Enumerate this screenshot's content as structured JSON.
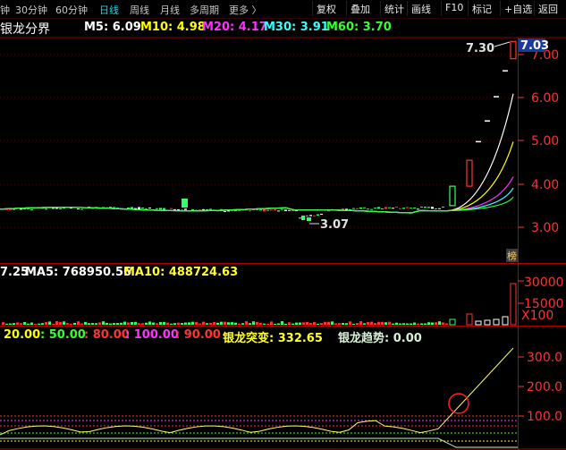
{
  "toolbar": {
    "periods": [
      "钟",
      "30分钟",
      "60分钟",
      "日线",
      "周线",
      "月线",
      "多周期",
      "更多 〉"
    ],
    "active_period": "日线",
    "buttons": [
      "复权",
      "叠加",
      "统计",
      "画线",
      "F10",
      "标记",
      "+自选",
      "返回"
    ]
  },
  "main_panel": {
    "title": "银龙分界",
    "ma": [
      {
        "label": "M5: 6.09",
        "color": "#ffffff"
      },
      {
        "label": "M10: 4.98",
        "color": "#ffff00"
      },
      {
        "label": "M20: 4.17",
        "color": "#ff33ff"
      },
      {
        "label": "M30: 3.91",
        "color": "#33ffff"
      },
      {
        "label": "M60: 3.70",
        "color": "#33ff33"
      }
    ],
    "price_axis": [
      "7.00",
      "6.00",
      "5.00",
      "4.00",
      "3.00"
    ],
    "high_label": "7.30",
    "low_label": "3.07",
    "current_price": "7.03",
    "corner_tag": "榜"
  },
  "volume_panel": {
    "vol_label": "7.25",
    "ma5_label": "MA5: 768950.56",
    "ma10_label": "MA10: 488724.63",
    "axis": [
      "30000",
      "15000"
    ],
    "unit": "X100"
  },
  "indicator_panel": {
    "levels": [
      {
        "label": "20.00",
        "color": "#ffff00"
      },
      {
        "label": ": 50.00",
        "color": "#33ff33"
      },
      {
        "label": ": 80.00",
        "color": "#ff3333"
      },
      {
        "label": ": 100.00",
        "color": "#ff33ff"
      },
      {
        "label": ": 90.00",
        "color": "#ff3333"
      }
    ],
    "tupian_label": "银龙突变: 332.65",
    "trend_label": "银龙趋势: 0.00",
    "axis": [
      "300.0",
      "200.0",
      "100.0"
    ]
  },
  "colors": {
    "up": "#ff3232",
    "down": "#54ffff",
    "grid": "#8b0000",
    "axis_text": "#ff3232"
  }
}
